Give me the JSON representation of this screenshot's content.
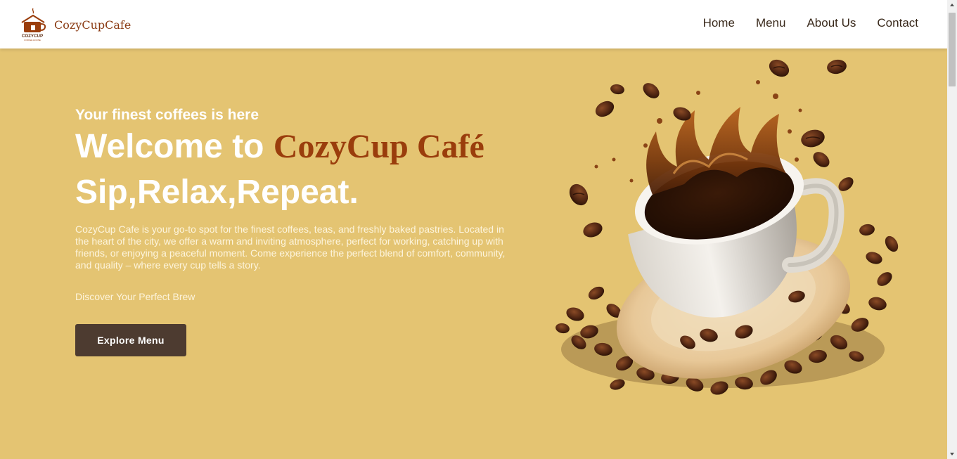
{
  "header": {
    "brand": "CozyCupCafe",
    "logo_text": "COZYCUP",
    "logo_subtext": "COFFEE HOUSE",
    "nav": [
      "Home",
      "Menu",
      "About Us",
      "Contact"
    ]
  },
  "hero": {
    "tagline": "Your finest coffees is here",
    "headline_prefix": "Welcome to ",
    "headline_brand": "CozyCup Café",
    "subhead": "Sip,Relax,Repeat.",
    "description": "CozyCup Cafe is your go-to spot for the finest coffees, teas, and freshly baked pastries. Located in the heart of the city, we offer a warm and inviting atmosphere, perfect for working, catching up with friends, or enjoying a peaceful moment. Come experience the perfect blend of comfort, community, and quality – where every cup tells a story.",
    "discover": "Discover Your Perfect Brew",
    "cta_label": "Explore Menu"
  },
  "colors": {
    "hero_bg": "#e4c472",
    "brand_accent": "#9a3d0c",
    "button_bg": "#4d3b30"
  },
  "icons": {
    "logo": "coffee-house-logo-icon",
    "hero_image": "coffee-cup-splash-image"
  }
}
